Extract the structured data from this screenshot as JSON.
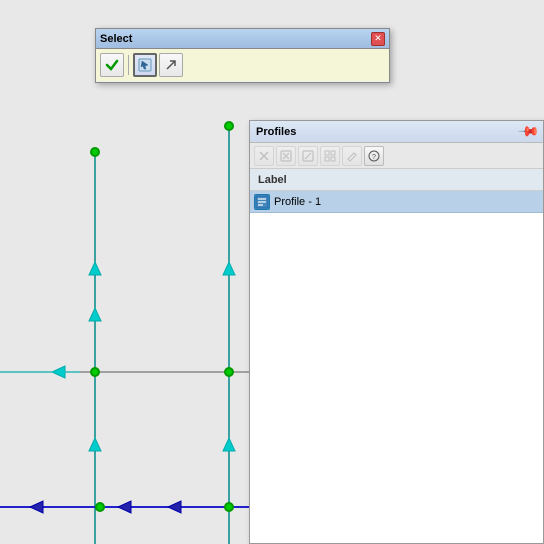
{
  "canvas": {
    "background": "#e0e0e0"
  },
  "select_dialog": {
    "title": "Select",
    "close_label": "✕",
    "toolbar": {
      "btn1_label": "✓",
      "btn2_label": "⊕",
      "btn3_label": "↗"
    }
  },
  "profiles_panel": {
    "title": "Profiles",
    "pin_symbol": "📌",
    "toolbar_buttons": [
      "✕",
      "✖",
      "✎",
      "⊞",
      "✏",
      "?"
    ],
    "column_label": "Label",
    "items": [
      {
        "label": "Profile - 1",
        "icon": "P"
      }
    ]
  }
}
